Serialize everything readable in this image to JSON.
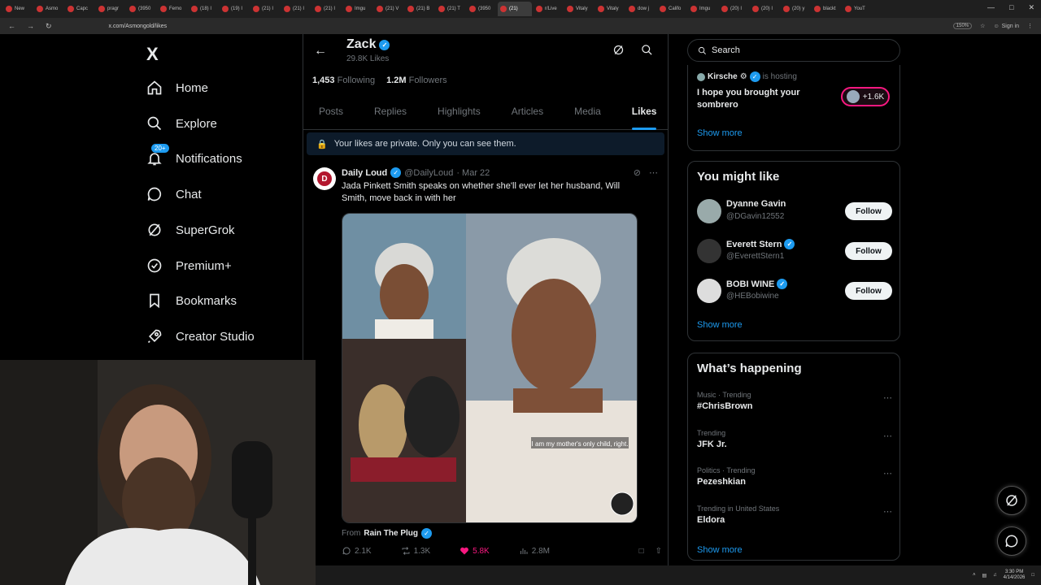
{
  "browser": {
    "tabs": [
      "New",
      "Asmo",
      "Capc",
      "pragr",
      "(3950",
      "Femo",
      "(18) I",
      "(19) I",
      "(21) I",
      "(21) I",
      "(21) I",
      "Imgu",
      "(21) V",
      "(21) B",
      "(21) T",
      "(3950",
      "(21)",
      "r/Live",
      "Vitaly",
      "Vitaly",
      "dow j",
      "Califo",
      "Imgu",
      "(20) I",
      "(20) I",
      "(20) y",
      "blackt",
      "YouT"
    ],
    "active_tab": "(21)",
    "url": "x.com/Asmongold/likes",
    "zoom": "150%",
    "signin": "Sign in"
  },
  "nav": {
    "logo": "X",
    "items": [
      {
        "label": "Home",
        "icon": "home-icon"
      },
      {
        "label": "Explore",
        "icon": "search-icon"
      },
      {
        "label": "Notifications",
        "icon": "bell-icon",
        "badge": "20+"
      },
      {
        "label": "Chat",
        "icon": "chat-icon"
      },
      {
        "label": "SuperGrok",
        "icon": "grok-icon"
      },
      {
        "label": "Premium+",
        "icon": "premium-icon"
      },
      {
        "label": "Bookmarks",
        "icon": "bookmark-icon"
      },
      {
        "label": "Creator Studio",
        "icon": "rocket-icon"
      }
    ]
  },
  "profile": {
    "name": "Zack",
    "likes": "29.8K Likes",
    "following_count": "1,453",
    "following_label": "Following",
    "followers_count": "1.2M",
    "followers_label": "Followers",
    "tabs": [
      "Posts",
      "Replies",
      "Highlights",
      "Articles",
      "Media",
      "Likes"
    ],
    "active_tab": "Likes",
    "private_notice": "Your likes are private. Only you can see them."
  },
  "tweet": {
    "author": "Daily Loud",
    "handle": "@DailyLoud",
    "date": "· Mar 22",
    "avatar_text": "D",
    "text": "Jada Pinkett Smith speaks on whether she'll ever let her husband, Will Smith, move back in with her",
    "caption": "I am my mother's only child, right.",
    "from_label": "From",
    "from_name": "Rain The Plug",
    "replies": "2.1K",
    "reposts": "1.3K",
    "likes": "5.8K",
    "views": "2.8M"
  },
  "right": {
    "search_placeholder": "Search",
    "space": {
      "host": "Kirsche",
      "host_suffix": "is hosting",
      "title": "I hope you brought your sombrero",
      "listeners": "+1.6K",
      "show_more": "Show more"
    },
    "wtf": {
      "title": "You might like",
      "users": [
        {
          "name": "Dyanne Gavin",
          "handle": "@DGavin12552",
          "verified": false,
          "button": "Follow"
        },
        {
          "name": "Everett Stern",
          "handle": "@EverettStern1",
          "verified": true,
          "button": "Follow"
        },
        {
          "name": "BOBI WINE",
          "handle": "@HEBobiwine",
          "verified": true,
          "button": "Follow"
        }
      ],
      "show_more": "Show more"
    },
    "happening": {
      "title": "What’s happening",
      "trends": [
        {
          "category": "Music · Trending",
          "name": "#ChrisBrown"
        },
        {
          "category": "Trending",
          "name": "JFK Jr."
        },
        {
          "category": "Politics · Trending",
          "name": "Pezeshkian"
        },
        {
          "category": "Trending in United States",
          "name": "Eldora"
        }
      ],
      "show_more": "Show more"
    }
  },
  "taskbar": {
    "time": "3:30 PM",
    "date": "4/14/2026"
  },
  "colors": {
    "accent": "#1d9bf0",
    "like": "#f91880",
    "bg": "#000000",
    "border": "#2f3336",
    "muted": "#71767b"
  }
}
